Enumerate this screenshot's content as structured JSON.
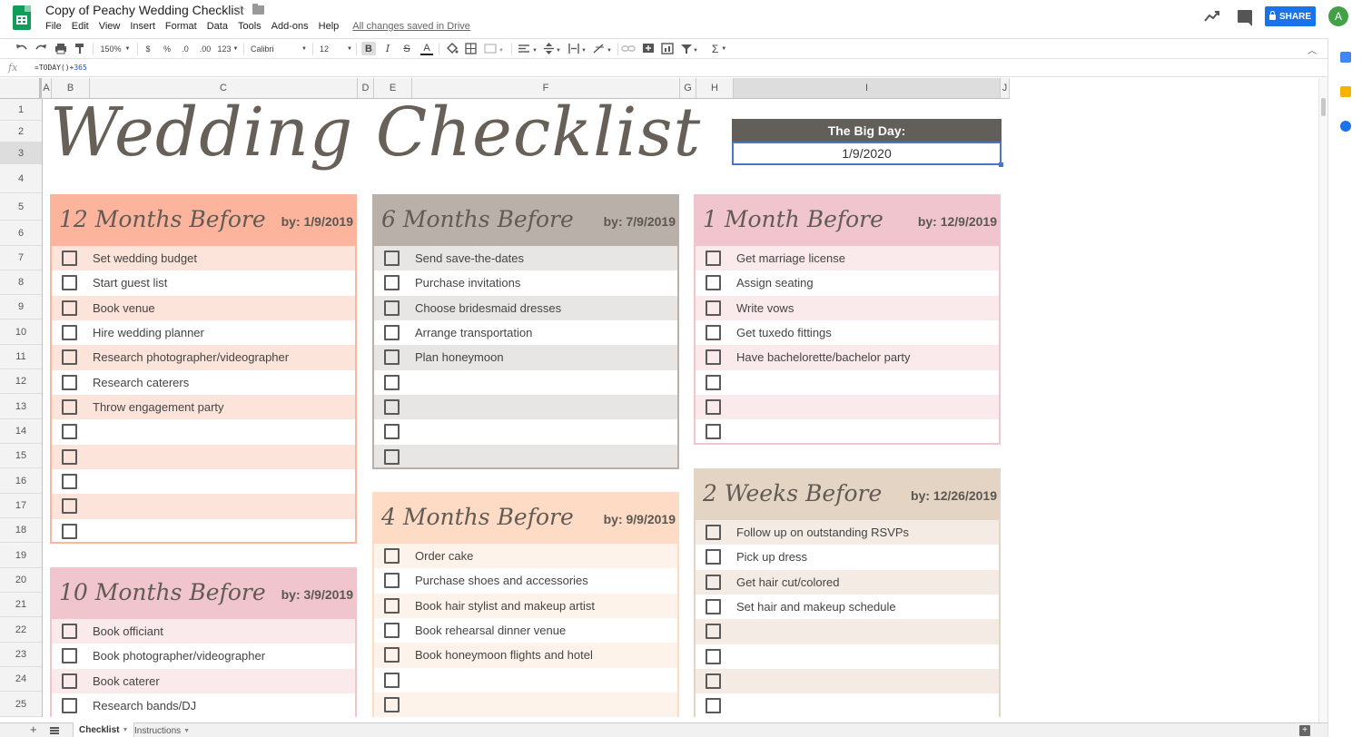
{
  "doc": {
    "title": "Copy of Peachy Wedding Checklist",
    "saved_status": "All changes saved in Drive"
  },
  "menu": [
    "File",
    "Edit",
    "View",
    "Insert",
    "Format",
    "Data",
    "Tools",
    "Add-ons",
    "Help"
  ],
  "share_label": "SHARE",
  "avatar_initial": "A",
  "toolbar": {
    "zoom": "150%",
    "currency": "$",
    "percent": "%",
    "dec_less": ".0",
    "dec_more": ".00",
    "format_more": "123",
    "font": "Calibri",
    "font_size": "12",
    "bold": "B",
    "italic": "I",
    "strike": "S",
    "text_color": "A",
    "functions": "Σ"
  },
  "formula": {
    "prefix": "=TODAY()+",
    "number": "365"
  },
  "columns": [
    "A",
    "B",
    "C",
    "D",
    "E",
    "F",
    "G",
    "H",
    "I",
    "J"
  ],
  "rows": [
    "1",
    "2",
    "3",
    "4",
    "5",
    "6",
    "7",
    "8",
    "9",
    "10",
    "11",
    "12",
    "13",
    "14",
    "15",
    "16",
    "17",
    "18",
    "19",
    "20",
    "21",
    "22",
    "23",
    "24",
    "25"
  ],
  "sheet_title": "Wedding Checklist",
  "big_day": {
    "label": "The Big Day:",
    "date": "1/9/2020"
  },
  "colors": {
    "peach_head": "#fcb49d",
    "peach_band": "#fde4da",
    "grey_head": "#b8b0a9",
    "grey_band": "#e8e6e4",
    "pink_head": "#f0c5cd",
    "pink_band": "#faeaec",
    "cream_head": "#fddbc4",
    "cream_band": "#fef3eb",
    "tan_head": "#e4d4c4",
    "tan_band": "#f3ebe4",
    "selection": "#4a76c9"
  },
  "panels": {
    "m12": {
      "title": "12 Months Before",
      "date": "by: 1/9/2019",
      "items": [
        "Set wedding budget",
        "Start guest list",
        "Book venue",
        "Hire wedding planner",
        "Research photographer/videographer",
        "Research caterers",
        "Throw engagement party",
        "",
        "",
        "",
        "",
        ""
      ]
    },
    "m10": {
      "title": "10 Months Before",
      "date": "by: 3/9/2019",
      "items": [
        "Book officiant",
        "Book photographer/videographer",
        "Book caterer",
        "Research bands/DJ"
      ]
    },
    "m6": {
      "title": "6 Months Before",
      "date": "by: 7/9/2019",
      "items": [
        "Send save-the-dates",
        "Purchase invitations",
        "Choose bridesmaid dresses",
        "Arrange transportation",
        "Plan honeymoon",
        "",
        "",
        "",
        ""
      ]
    },
    "m4": {
      "title": "4 Months Before",
      "date": "by: 9/9/2019",
      "items": [
        "Order cake",
        "Purchase shoes and accessories",
        "Book hair stylist and makeup artist",
        "Book rehearsal dinner venue",
        "Book honeymoon flights and hotel",
        "",
        ""
      ]
    },
    "m1": {
      "title": "1 Month Before",
      "date": "by: 12/9/2019",
      "items": [
        "Get marriage license",
        "Assign seating",
        "Write vows",
        "Get tuxedo fittings",
        "Have bachelorette/bachelor party",
        "",
        "",
        ""
      ]
    },
    "w2": {
      "title": "2 Weeks Before",
      "date": "by: 12/26/2019",
      "items": [
        "Follow up on outstanding RSVPs",
        "Pick up dress",
        "Get hair cut/colored",
        "Set hair and makeup schedule",
        "",
        "",
        "",
        ""
      ]
    }
  },
  "tabs": {
    "active": "Checklist",
    "other": "Instructions"
  }
}
